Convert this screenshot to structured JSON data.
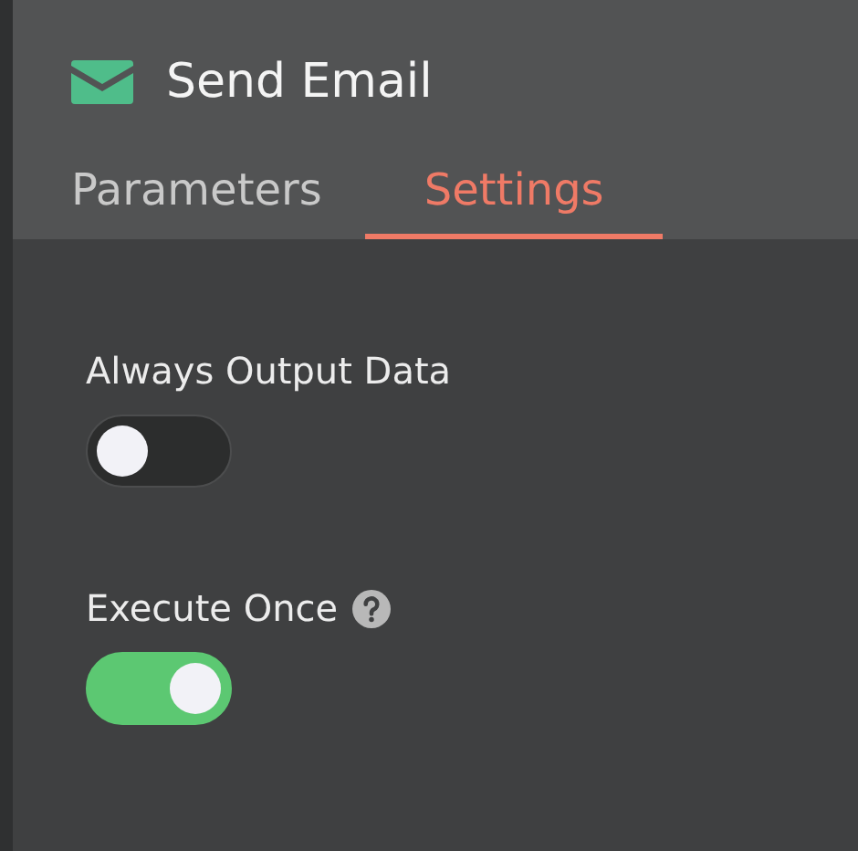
{
  "header": {
    "title": "Send Email"
  },
  "tabs": [
    {
      "label": "Parameters",
      "selected": false
    },
    {
      "label": "Settings",
      "selected": true
    }
  ],
  "settings": [
    {
      "label": "Always Output Data",
      "on": false,
      "help": false
    },
    {
      "label": "Execute Once",
      "on": true,
      "help": true
    }
  ]
}
